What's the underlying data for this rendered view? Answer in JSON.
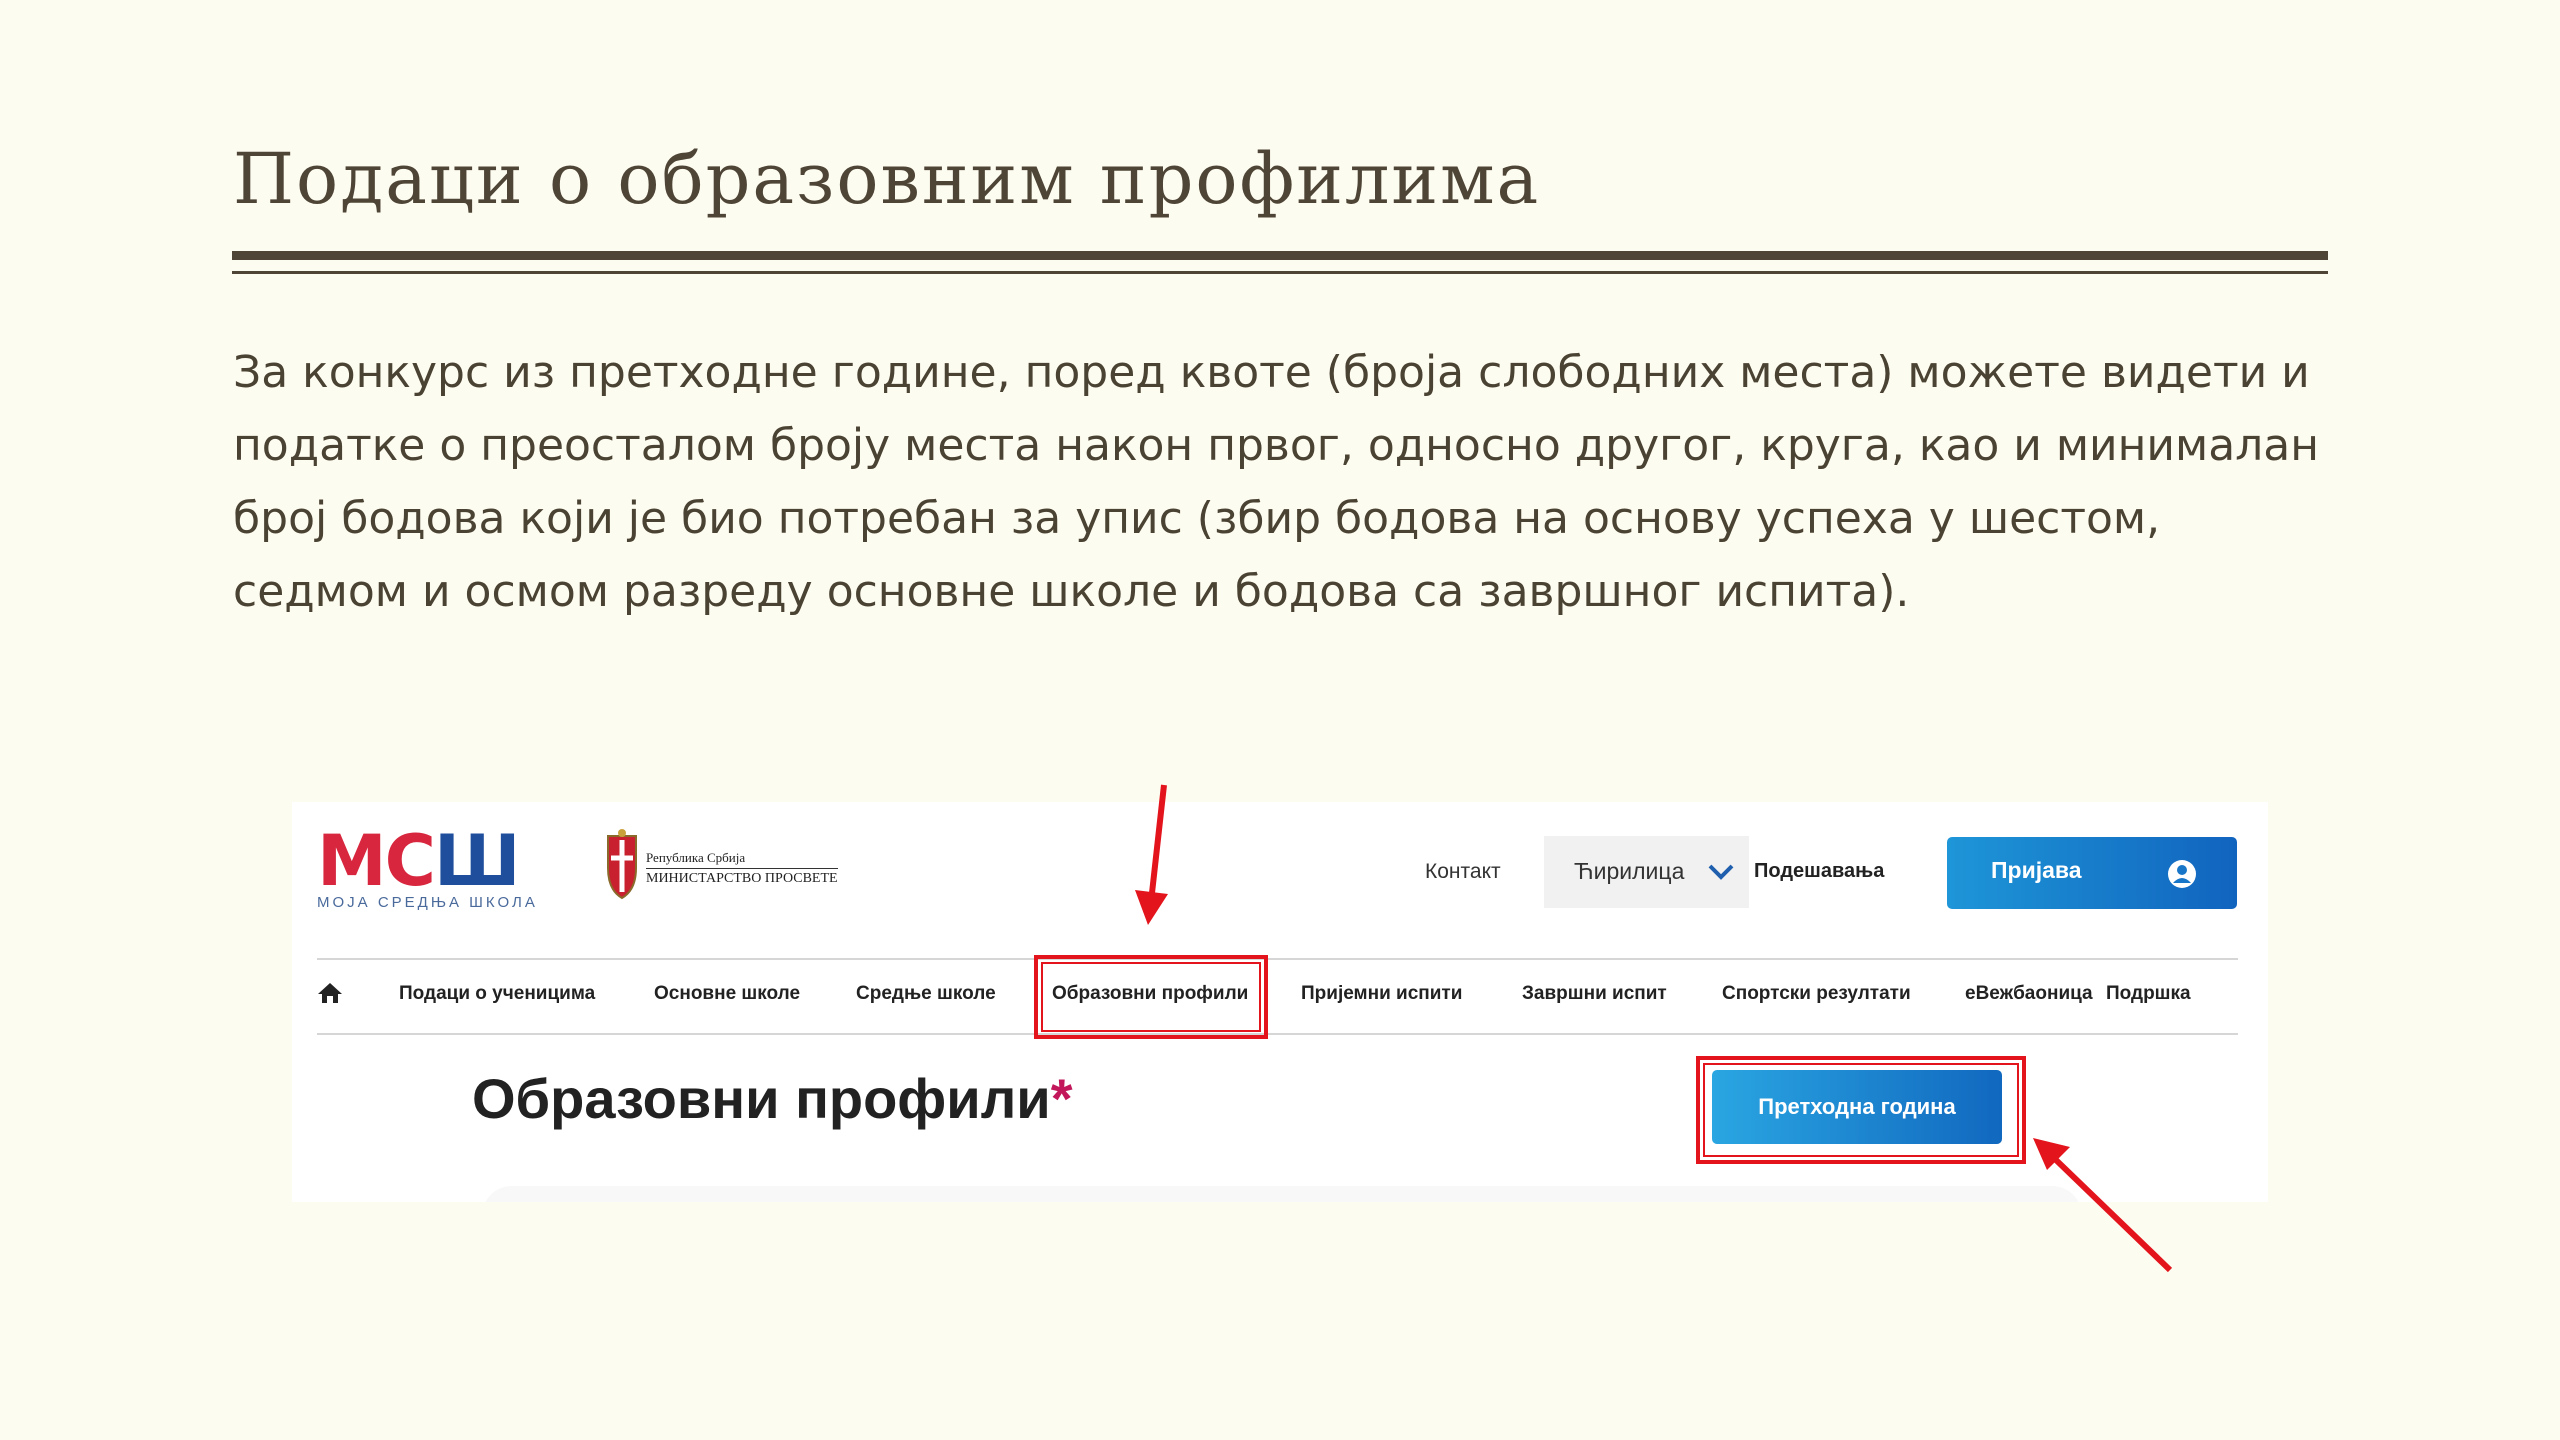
{
  "slide": {
    "title": "Подаци о образовним профилима",
    "body": "За конкурс из претходне године, поред квоте (броја слободних места) можете видети и податке о преосталом броју места након првог, односно другог, круга, као и минималан број бодова који је био потребан за упис (збир бодова на основу успеха у шестом, седмом и осмом разреду основне школе и бодова са завршног испита)."
  },
  "screenshot": {
    "logo": {
      "mark": "МСШ",
      "subtitle": "МОЈА СРЕДЊА ШКОЛА"
    },
    "ministry": {
      "line1": "Република Србија",
      "line2": "МИНИСТАРСТВО ПРОСВЕТЕ"
    },
    "header": {
      "contact": "Контакт",
      "language": "Ћирилица",
      "settings": "Подешавања",
      "login": "Пријава"
    },
    "nav": [
      "Подаци о ученицима",
      "Основне школе",
      "Средње школе",
      "Образовни профили",
      "Пријемни испити",
      "Завршни испит",
      "Спортски резултати",
      "еВежбаоница",
      "Подршка"
    ],
    "page_heading": "Образовни профили",
    "heading_marker": "*",
    "previous_year_button": "Претходна година"
  },
  "colors": {
    "slide_background": "#fdfcf0",
    "text": "#4a4232",
    "accent_blue": "#1164be",
    "highlight_red": "#e3141c",
    "brand_red": "#d7263d",
    "brand_blue": "#1f4e9c"
  }
}
